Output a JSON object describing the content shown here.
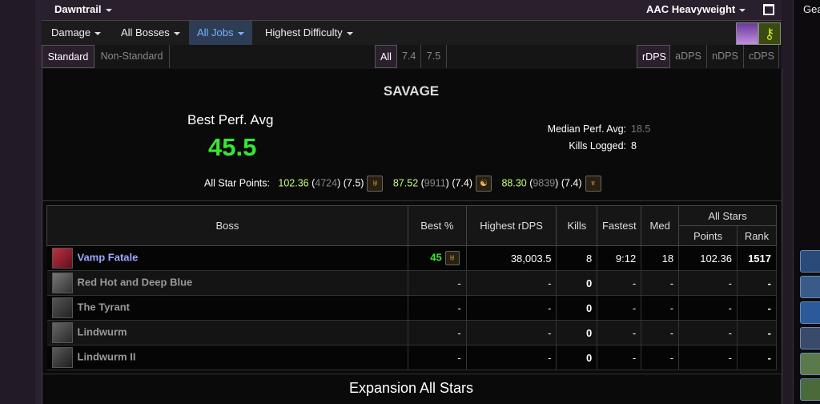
{
  "topbar": {
    "expansion": "Dawntrail",
    "character": "AAC Heavyweight"
  },
  "right_panel": {
    "title": "Gea"
  },
  "menu": {
    "items": [
      {
        "label": "Damage",
        "has_caret": true
      },
      {
        "label": "All Bosses",
        "has_caret": true
      },
      {
        "label": "All Jobs",
        "has_caret": true,
        "active": true
      },
      {
        "label": "Highest Difficulty",
        "has_caret": true
      }
    ]
  },
  "filters": {
    "standard": "Standard",
    "non_standard": "Non-Standard",
    "patches": [
      "All",
      "7.4",
      "7.5"
    ],
    "roles": [
      "rDPS",
      "aDPS",
      "nDPS",
      "cDPS"
    ]
  },
  "summary": {
    "section_title": "SAVAGE",
    "best_perf_label": "Best Perf. Avg",
    "best_perf_value": "45.5",
    "median_label": "Median Perf. Avg:",
    "median_value": "18.5",
    "kills_label": "Kills Logged:",
    "kills_value": "8",
    "all_star_label": "All Star Points:",
    "all_star": [
      {
        "points": "102.36",
        "rank": "4724",
        "patch": "(7.5)",
        "icon": "job-icon"
      },
      {
        "points": "87.52",
        "rank": "9911",
        "patch": "(7.4)",
        "icon": "job-icon"
      },
      {
        "points": "88.30",
        "rank": "9839",
        "patch": "(7.4)",
        "icon": "job-icon"
      }
    ]
  },
  "table": {
    "headers": {
      "boss": "Boss",
      "best": "Best %",
      "highest": "Highest rDPS",
      "kills": "Kills",
      "fastest": "Fastest",
      "med": "Med",
      "all_stars": "All Stars",
      "points": "Points",
      "rank": "Rank"
    },
    "rows": [
      {
        "boss": "Vamp Fatale",
        "best": "45",
        "highest": "38,003.5",
        "kills": "8",
        "fastest": "9:12",
        "med": "18",
        "points": "102.36",
        "rank": "1517",
        "active": true
      },
      {
        "boss": "Red Hot and Deep Blue",
        "best": "-",
        "highest": "-",
        "kills": "0",
        "fastest": "-",
        "med": "-",
        "points": "-",
        "rank": "-"
      },
      {
        "boss": "The Tyrant",
        "best": "-",
        "highest": "-",
        "kills": "0",
        "fastest": "-",
        "med": "-",
        "points": "-",
        "rank": "-"
      },
      {
        "boss": "Lindwurm",
        "best": "-",
        "highest": "-",
        "kills": "0",
        "fastest": "-",
        "med": "-",
        "points": "-",
        "rank": "-"
      },
      {
        "boss": "Lindwurm II",
        "best": "-",
        "highest": "-",
        "kills": "0",
        "fastest": "-",
        "med": "-",
        "points": "-",
        "rank": "-"
      }
    ]
  },
  "expansion_all_stars": "Expansion All Stars",
  "colors": {
    "accent": "#7fb0ff",
    "perf_green": "#36e636",
    "dps_purple": "#c48ff5",
    "points_lime": "#c8ff7a"
  }
}
